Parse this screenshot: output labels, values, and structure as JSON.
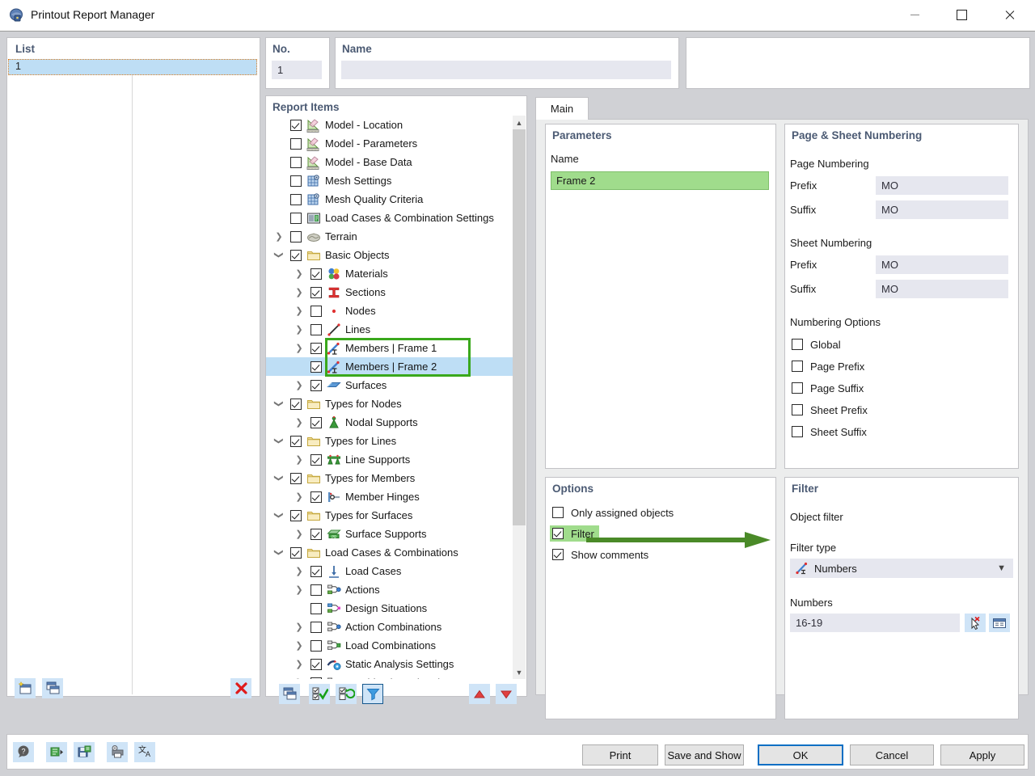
{
  "window": {
    "title": "Printout Report Manager",
    "icon": "app-icon",
    "minimize": "minimize-icon",
    "maximize": "maximize-icon",
    "close": "close-icon"
  },
  "list": {
    "header": "List",
    "rows": [
      {
        "no": "1",
        "name": ""
      }
    ],
    "toolbar": [
      {
        "name": "new-printout-report-button",
        "icon": "new-window-icon"
      },
      {
        "name": "copy-printout-report-button",
        "icon": "copy-window-icon"
      },
      {
        "name": "delete-printout-report-button",
        "icon": "red-x-icon"
      }
    ]
  },
  "no_field": {
    "label": "No.",
    "value": "1"
  },
  "name_field": {
    "label": "Name",
    "value": ""
  },
  "report_items": {
    "title": "Report Items",
    "items": [
      {
        "label": "Model - Location",
        "checked": true,
        "indent": 0,
        "expander": "",
        "icon": "model-location-icon",
        "selected": false
      },
      {
        "label": "Model - Parameters",
        "checked": false,
        "indent": 0,
        "expander": "",
        "icon": "model-parameters-icon",
        "selected": false
      },
      {
        "label": "Model - Base Data",
        "checked": false,
        "indent": 0,
        "expander": "",
        "icon": "model-base-data-icon",
        "selected": false
      },
      {
        "label": "Mesh Settings",
        "checked": false,
        "indent": 0,
        "expander": "",
        "icon": "mesh-settings-icon",
        "selected": false
      },
      {
        "label": "Mesh Quality Criteria",
        "checked": false,
        "indent": 0,
        "expander": "",
        "icon": "mesh-quality-icon",
        "selected": false
      },
      {
        "label": "Load Cases & Combination Settings",
        "checked": false,
        "indent": 0,
        "expander": "",
        "icon": "load-case-settings-icon",
        "selected": false
      },
      {
        "label": "Terrain",
        "checked": false,
        "indent": 0,
        "expander": "collapsed",
        "icon": "terrain-icon",
        "selected": false
      },
      {
        "label": "Basic Objects",
        "checked": true,
        "indent": 0,
        "expander": "expanded",
        "icon": "folder-icon",
        "selected": false
      },
      {
        "label": "Materials",
        "checked": true,
        "indent": 1,
        "expander": "collapsed",
        "icon": "materials-icon",
        "selected": false
      },
      {
        "label": "Sections",
        "checked": true,
        "indent": 1,
        "expander": "collapsed",
        "icon": "sections-icon",
        "selected": false
      },
      {
        "label": "Nodes",
        "checked": false,
        "indent": 1,
        "expander": "collapsed",
        "icon": "node-icon",
        "selected": false
      },
      {
        "label": "Lines",
        "checked": false,
        "indent": 1,
        "expander": "collapsed",
        "icon": "line-icon",
        "selected": false
      },
      {
        "label": "Members | Frame 1",
        "checked": true,
        "indent": 1,
        "expander": "collapsed",
        "icon": "member-icon",
        "selected": false
      },
      {
        "label": "Members | Frame 2",
        "checked": true,
        "indent": 1,
        "expander": "",
        "icon": "member-icon",
        "selected": true
      },
      {
        "label": "Surfaces",
        "checked": true,
        "indent": 1,
        "expander": "collapsed",
        "icon": "surface-icon",
        "selected": false
      },
      {
        "label": "Types for Nodes",
        "checked": true,
        "indent": 0,
        "expander": "expanded",
        "icon": "folder-icon",
        "selected": false
      },
      {
        "label": "Nodal Supports",
        "checked": true,
        "indent": 1,
        "expander": "collapsed",
        "icon": "nodal-support-icon",
        "selected": false
      },
      {
        "label": "Types for Lines",
        "checked": true,
        "indent": 0,
        "expander": "expanded",
        "icon": "folder-icon",
        "selected": false
      },
      {
        "label": "Line Supports",
        "checked": true,
        "indent": 1,
        "expander": "collapsed",
        "icon": "line-support-icon",
        "selected": false
      },
      {
        "label": "Types for Members",
        "checked": true,
        "indent": 0,
        "expander": "expanded",
        "icon": "folder-icon",
        "selected": false
      },
      {
        "label": "Member Hinges",
        "checked": true,
        "indent": 1,
        "expander": "collapsed",
        "icon": "member-hinge-icon",
        "selected": false
      },
      {
        "label": "Types for Surfaces",
        "checked": true,
        "indent": 0,
        "expander": "expanded",
        "icon": "folder-icon",
        "selected": false
      },
      {
        "label": "Surface Supports",
        "checked": true,
        "indent": 1,
        "expander": "collapsed",
        "icon": "surface-support-icon",
        "selected": false
      },
      {
        "label": "Load Cases & Combinations",
        "checked": true,
        "indent": 0,
        "expander": "expanded",
        "icon": "folder-icon",
        "selected": false
      },
      {
        "label": "Load Cases",
        "checked": true,
        "indent": 1,
        "expander": "collapsed",
        "icon": "load-case-icon",
        "selected": false
      },
      {
        "label": "Actions",
        "checked": false,
        "indent": 1,
        "expander": "collapsed",
        "icon": "actions-icon",
        "selected": false
      },
      {
        "label": "Design Situations",
        "checked": false,
        "indent": 1,
        "expander": "",
        "icon": "design-situations-icon",
        "selected": false
      },
      {
        "label": "Action Combinations",
        "checked": false,
        "indent": 1,
        "expander": "collapsed",
        "icon": "action-combinations-icon",
        "selected": false
      },
      {
        "label": "Load Combinations",
        "checked": false,
        "indent": 1,
        "expander": "collapsed",
        "icon": "load-combinations-icon",
        "selected": false
      },
      {
        "label": "Static Analysis Settings",
        "checked": true,
        "indent": 1,
        "expander": "collapsed",
        "icon": "static-analysis-icon",
        "selected": false
      },
      {
        "label": "Combination Wizards",
        "checked": true,
        "indent": 1,
        "expander": "collapsed",
        "icon": "combination-wizards-icon",
        "selected": false
      },
      {
        "label": "",
        "checked": false,
        "indent": 0,
        "expander": "collapsed",
        "icon": "folder-icon",
        "selected": false
      }
    ],
    "toolbar": [
      {
        "name": "tree-copy-button",
        "icon": "copy-window-icon",
        "active": false
      },
      {
        "name": "tree-select-all-button",
        "icon": "check-all-icon",
        "active": false
      },
      {
        "name": "tree-invert-selection-button",
        "icon": "invert-selection-icon",
        "active": false
      },
      {
        "name": "tree-filter-button",
        "icon": "funnel-icon",
        "active": true
      },
      {
        "name": "tree-move-up-button",
        "icon": "arrow-up-icon",
        "active": false
      },
      {
        "name": "tree-move-down-button",
        "icon": "arrow-down-icon",
        "active": false
      }
    ]
  },
  "tabs": [
    {
      "label": "Main",
      "active": true
    }
  ],
  "parameters": {
    "title": "Parameters",
    "column": "Name",
    "value": "Frame 2",
    "highlight_color": "#a0dc8c"
  },
  "page_sheet_numbering": {
    "title": "Page & Sheet Numbering",
    "page_numbering": {
      "heading": "Page Numbering",
      "prefix_label": "Prefix",
      "prefix_value": "MO",
      "suffix_label": "Suffix",
      "suffix_value": "MO"
    },
    "sheet_numbering": {
      "heading": "Sheet Numbering",
      "prefix_label": "Prefix",
      "prefix_value": "MO",
      "suffix_label": "Suffix",
      "suffix_value": "MO"
    },
    "numbering_options": {
      "heading": "Numbering Options",
      "items": [
        {
          "label": "Global",
          "checked": false
        },
        {
          "label": "Page Prefix",
          "checked": false
        },
        {
          "label": "Page Suffix",
          "checked": false
        },
        {
          "label": "Sheet Prefix",
          "checked": false
        },
        {
          "label": "Sheet Suffix",
          "checked": false
        }
      ]
    }
  },
  "options": {
    "title": "Options",
    "items": [
      {
        "label": "Only assigned objects",
        "checked": false,
        "highlighted": false
      },
      {
        "label": "Filter",
        "checked": true,
        "highlighted": true
      },
      {
        "label": "Show comments",
        "checked": true,
        "highlighted": false
      }
    ],
    "annotation_arrow_color": "#4a8a28"
  },
  "filter": {
    "title": "Filter",
    "object_filter_label": "Object filter",
    "filter_type_label": "Filter type",
    "filter_type_value": "Numbers",
    "numbers_label": "Numbers",
    "numbers_value": "16-19",
    "buttons": [
      {
        "name": "pick-numbers-button",
        "icon": "pick-cursor-icon"
      },
      {
        "name": "numbers-dialog-button",
        "icon": "dialog-window-icon"
      }
    ]
  },
  "bottom_toolbar": [
    {
      "name": "help-button",
      "icon": "help-icon"
    },
    {
      "name": "settings-export-button",
      "icon": "export-icon"
    },
    {
      "name": "save-settings-button",
      "icon": "save-icon"
    },
    {
      "name": "printer-settings-button",
      "icon": "printer-settings-icon"
    },
    {
      "name": "language-button",
      "icon": "translate-icon"
    }
  ],
  "dialog_buttons": [
    {
      "name": "print-button",
      "label": "Print",
      "default": false
    },
    {
      "name": "save-and-show-button",
      "label": "Save and Show",
      "default": false
    },
    {
      "name": "ok-button",
      "label": "OK",
      "default": true
    },
    {
      "name": "cancel-button",
      "label": "Cancel",
      "default": false
    },
    {
      "name": "apply-button",
      "label": "Apply",
      "default": false
    }
  ]
}
